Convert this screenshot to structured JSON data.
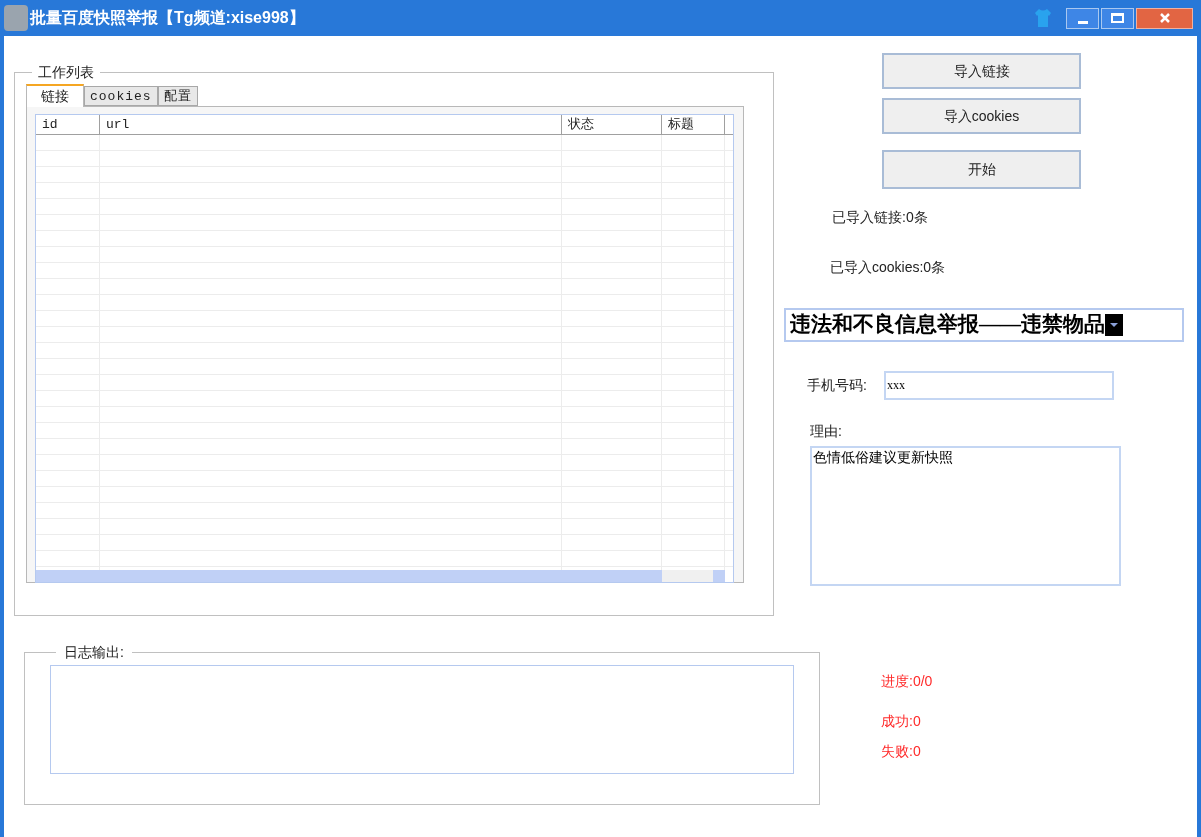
{
  "window": {
    "title": "批量百度快照举报【Tg频道:xise998】"
  },
  "work_list": {
    "title": "工作列表",
    "tabs": [
      {
        "label": "链接",
        "selected": true
      },
      {
        "label": "cookies",
        "selected": false
      },
      {
        "label": "配置",
        "selected": false
      }
    ],
    "table": {
      "columns": [
        "id",
        "url",
        "状态",
        "标题"
      ]
    }
  },
  "buttons": [
    "导入链接",
    "导入cookies",
    "开始"
  ],
  "counts": [
    "已导入链接:0条",
    "已导入cookies:0条"
  ],
  "report_type": {
    "value": "违法和不良信息举报——违禁物品"
  },
  "phone": {
    "label": "手机号码:",
    "value": "xxx"
  },
  "reason": {
    "label": "理由:",
    "value": "色情低俗建议更新快照"
  },
  "log": {
    "title": "日志输出:"
  },
  "stats": [
    "进度:0/0",
    "成功:0",
    "失败:0"
  ]
}
